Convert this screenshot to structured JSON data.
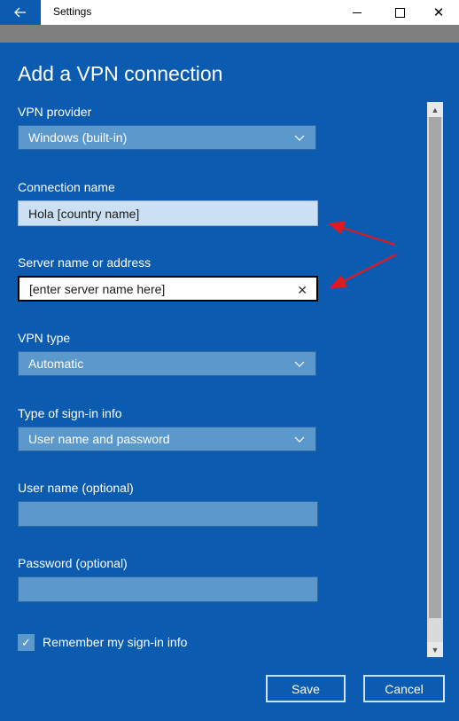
{
  "window": {
    "title": "Settings",
    "back_icon": "arrow-left-icon",
    "close_glyph": "✕"
  },
  "page": {
    "title": "Add a VPN connection"
  },
  "form": {
    "vpn_provider": {
      "label": "VPN provider",
      "value": "Windows (built-in)"
    },
    "connection_name": {
      "label": "Connection name",
      "value": "Hola [country name]"
    },
    "server": {
      "label": "Server name or address",
      "value": "[enter server name here]",
      "clear_glyph": "✕"
    },
    "vpn_type": {
      "label": "VPN type",
      "value": "Automatic"
    },
    "signin_type": {
      "label": "Type of sign-in info",
      "value": "User name and password"
    },
    "username": {
      "label": "User name (optional)",
      "value": ""
    },
    "password": {
      "label": "Password (optional)",
      "value": ""
    },
    "remember": {
      "label": "Remember my sign-in info",
      "checked": true,
      "glyph": "✓"
    }
  },
  "buttons": {
    "save": "Save",
    "cancel": "Cancel"
  },
  "scrollbar": {
    "up_glyph": "▲",
    "down_glyph": "▼"
  },
  "colors": {
    "background": "#0b5bb0",
    "field": "#5b98cc",
    "annotation_arrow": "#e0191e"
  }
}
